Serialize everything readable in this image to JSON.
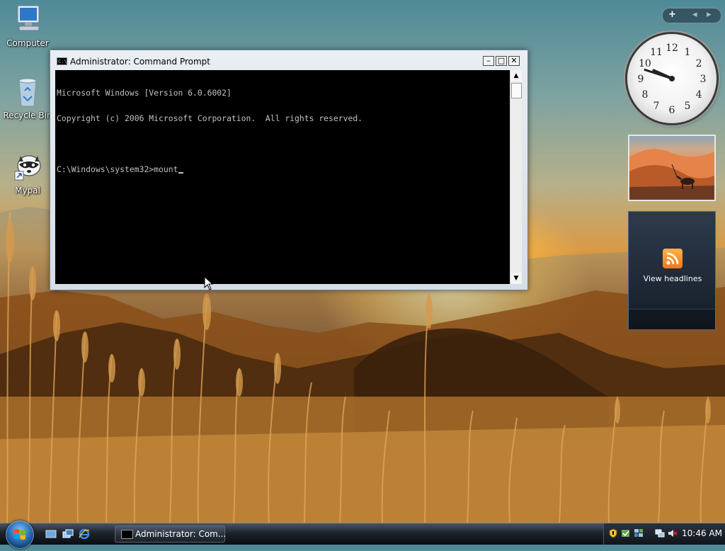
{
  "desktop": {
    "icons": [
      {
        "label": "Computer"
      },
      {
        "label": "Recycle Bin"
      },
      {
        "label": "Mypal"
      }
    ]
  },
  "cmd": {
    "title": "Administrator: Command Prompt",
    "icon_text": "C:\\.",
    "lines": [
      "Microsoft Windows [Version 6.0.6002]",
      "Copyright (c) 2006 Microsoft Corporation.  All rights reserved.",
      "",
      "C:\\Windows\\system32>mount"
    ],
    "buttons": {
      "minimize": "–",
      "maximize": "□",
      "close": "✕"
    }
  },
  "gadgets": {
    "controls": {
      "add": "+",
      "prev": "◂",
      "next": "▸"
    },
    "clock": {
      "numbers": [
        "12",
        "1",
        "2",
        "3",
        "4",
        "5",
        "6",
        "7",
        "8",
        "9",
        "10",
        "11"
      ],
      "hour": 9,
      "minute": 48
    },
    "feed": {
      "headline": "View headlines"
    }
  },
  "taskbar": {
    "task_label": "Administrator: Com...",
    "time": "10:46 AM"
  },
  "colors": {
    "console_bg": "#000000",
    "console_fg": "#c0c0c0",
    "taskbar": "#1d232b",
    "rss": "#f0781a"
  }
}
